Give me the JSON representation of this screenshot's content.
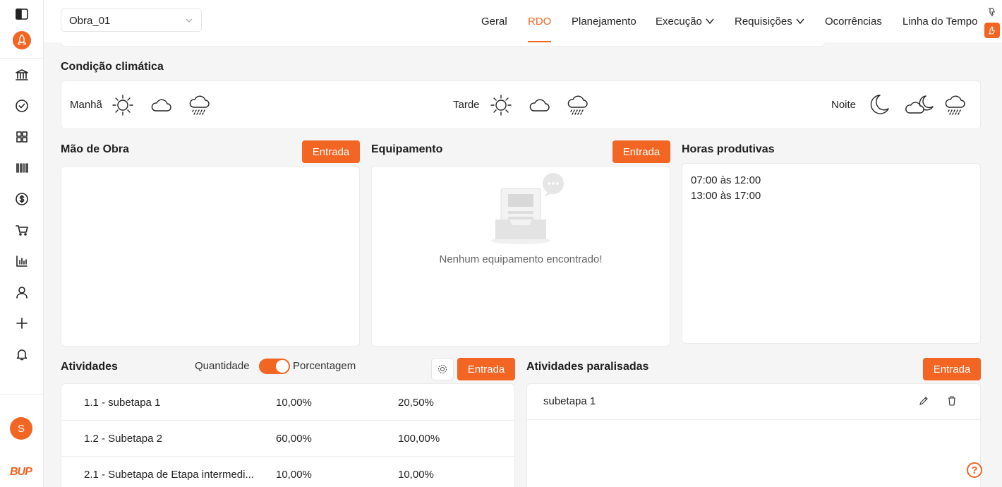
{
  "brand": {
    "logo_text": "BUP",
    "avatar_initial": "S"
  },
  "sidebar": {
    "items": [
      {
        "icon": "panel-toggle-icon"
      },
      {
        "icon": "rocket-icon"
      },
      {
        "icon": "bank-icon"
      },
      {
        "icon": "check-circle-icon"
      },
      {
        "icon": "grid-icon"
      },
      {
        "icon": "barcode-icon"
      },
      {
        "icon": "dollar-icon"
      },
      {
        "icon": "cart-icon"
      },
      {
        "icon": "bar-chart-icon"
      },
      {
        "icon": "user-icon"
      },
      {
        "icon": "plus-icon"
      },
      {
        "icon": "bell-icon"
      }
    ]
  },
  "header": {
    "project_select": "Obra_01",
    "nav": [
      {
        "label": "Geral"
      },
      {
        "label": "RDO",
        "active": true
      },
      {
        "label": "Planejamento"
      },
      {
        "label": "Execução"
      },
      {
        "label": "Requisições"
      },
      {
        "label": "Ocorrências"
      },
      {
        "label": "Linha do Tempo"
      }
    ]
  },
  "weather": {
    "title": "Condição climática",
    "periods": [
      {
        "label": "Manhã",
        "icons": [
          "sun-icon",
          "cloud-icon",
          "rain-cloud-icon"
        ]
      },
      {
        "label": "Tarde",
        "icons": [
          "sun-icon",
          "cloud-icon",
          "rain-cloud-icon"
        ]
      },
      {
        "label": "Noite",
        "icons": [
          "moon-icon",
          "cloud-moon-icon",
          "rain-cloud-icon"
        ]
      }
    ]
  },
  "labor": {
    "title": "Mão de Obra",
    "button": "Entrada"
  },
  "equipment": {
    "title": "Equipamento",
    "button": "Entrada",
    "empty": "Nenhum equipamento encontrado!"
  },
  "hours": {
    "title": "Horas produtivas",
    "entries": [
      "07:00 às 12:00",
      "13:00 às 17:00"
    ]
  },
  "activities": {
    "title": "Atividades",
    "toggle_left": "Quantidade",
    "toggle_right": "Porcentagem",
    "button": "Entrada",
    "rows": [
      {
        "name": "1.1 - subetapa 1",
        "a": "10,00%",
        "b": "20,50%"
      },
      {
        "name": "1.2 - Subetapa 2",
        "a": "60,00%",
        "b": "100,00%"
      },
      {
        "name": "2.1 - Subetapa de Etapa intermedi...",
        "a": "10,00%",
        "b": "10,00%"
      }
    ]
  },
  "paused": {
    "title": "Atividades paralisadas",
    "button": "Entrada",
    "rows": [
      {
        "name": "subetapa 1"
      }
    ]
  },
  "colors": {
    "accent": "#f26522"
  }
}
